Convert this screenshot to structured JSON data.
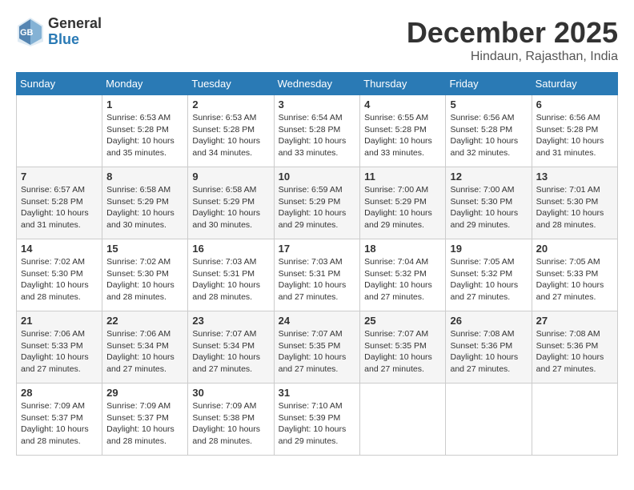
{
  "header": {
    "logo": {
      "general": "General",
      "blue": "Blue"
    },
    "title": "December 2025",
    "subtitle": "Hindaun, Rajasthan, India"
  },
  "calendar": {
    "columns": [
      "Sunday",
      "Monday",
      "Tuesday",
      "Wednesday",
      "Thursday",
      "Friday",
      "Saturday"
    ],
    "weeks": [
      [
        {
          "day": "",
          "info": ""
        },
        {
          "day": "1",
          "info": "Sunrise: 6:53 AM\nSunset: 5:28 PM\nDaylight: 10 hours\nand 35 minutes."
        },
        {
          "day": "2",
          "info": "Sunrise: 6:53 AM\nSunset: 5:28 PM\nDaylight: 10 hours\nand 34 minutes."
        },
        {
          "day": "3",
          "info": "Sunrise: 6:54 AM\nSunset: 5:28 PM\nDaylight: 10 hours\nand 33 minutes."
        },
        {
          "day": "4",
          "info": "Sunrise: 6:55 AM\nSunset: 5:28 PM\nDaylight: 10 hours\nand 33 minutes."
        },
        {
          "day": "5",
          "info": "Sunrise: 6:56 AM\nSunset: 5:28 PM\nDaylight: 10 hours\nand 32 minutes."
        },
        {
          "day": "6",
          "info": "Sunrise: 6:56 AM\nSunset: 5:28 PM\nDaylight: 10 hours\nand 31 minutes."
        }
      ],
      [
        {
          "day": "7",
          "info": "Sunrise: 6:57 AM\nSunset: 5:28 PM\nDaylight: 10 hours\nand 31 minutes."
        },
        {
          "day": "8",
          "info": "Sunrise: 6:58 AM\nSunset: 5:29 PM\nDaylight: 10 hours\nand 30 minutes."
        },
        {
          "day": "9",
          "info": "Sunrise: 6:58 AM\nSunset: 5:29 PM\nDaylight: 10 hours\nand 30 minutes."
        },
        {
          "day": "10",
          "info": "Sunrise: 6:59 AM\nSunset: 5:29 PM\nDaylight: 10 hours\nand 29 minutes."
        },
        {
          "day": "11",
          "info": "Sunrise: 7:00 AM\nSunset: 5:29 PM\nDaylight: 10 hours\nand 29 minutes."
        },
        {
          "day": "12",
          "info": "Sunrise: 7:00 AM\nSunset: 5:30 PM\nDaylight: 10 hours\nand 29 minutes."
        },
        {
          "day": "13",
          "info": "Sunrise: 7:01 AM\nSunset: 5:30 PM\nDaylight: 10 hours\nand 28 minutes."
        }
      ],
      [
        {
          "day": "14",
          "info": "Sunrise: 7:02 AM\nSunset: 5:30 PM\nDaylight: 10 hours\nand 28 minutes."
        },
        {
          "day": "15",
          "info": "Sunrise: 7:02 AM\nSunset: 5:30 PM\nDaylight: 10 hours\nand 28 minutes."
        },
        {
          "day": "16",
          "info": "Sunrise: 7:03 AM\nSunset: 5:31 PM\nDaylight: 10 hours\nand 28 minutes."
        },
        {
          "day": "17",
          "info": "Sunrise: 7:03 AM\nSunset: 5:31 PM\nDaylight: 10 hours\nand 27 minutes."
        },
        {
          "day": "18",
          "info": "Sunrise: 7:04 AM\nSunset: 5:32 PM\nDaylight: 10 hours\nand 27 minutes."
        },
        {
          "day": "19",
          "info": "Sunrise: 7:05 AM\nSunset: 5:32 PM\nDaylight: 10 hours\nand 27 minutes."
        },
        {
          "day": "20",
          "info": "Sunrise: 7:05 AM\nSunset: 5:33 PM\nDaylight: 10 hours\nand 27 minutes."
        }
      ],
      [
        {
          "day": "21",
          "info": "Sunrise: 7:06 AM\nSunset: 5:33 PM\nDaylight: 10 hours\nand 27 minutes."
        },
        {
          "day": "22",
          "info": "Sunrise: 7:06 AM\nSunset: 5:34 PM\nDaylight: 10 hours\nand 27 minutes."
        },
        {
          "day": "23",
          "info": "Sunrise: 7:07 AM\nSunset: 5:34 PM\nDaylight: 10 hours\nand 27 minutes."
        },
        {
          "day": "24",
          "info": "Sunrise: 7:07 AM\nSunset: 5:35 PM\nDaylight: 10 hours\nand 27 minutes."
        },
        {
          "day": "25",
          "info": "Sunrise: 7:07 AM\nSunset: 5:35 PM\nDaylight: 10 hours\nand 27 minutes."
        },
        {
          "day": "26",
          "info": "Sunrise: 7:08 AM\nSunset: 5:36 PM\nDaylight: 10 hours\nand 27 minutes."
        },
        {
          "day": "27",
          "info": "Sunrise: 7:08 AM\nSunset: 5:36 PM\nDaylight: 10 hours\nand 27 minutes."
        }
      ],
      [
        {
          "day": "28",
          "info": "Sunrise: 7:09 AM\nSunset: 5:37 PM\nDaylight: 10 hours\nand 28 minutes."
        },
        {
          "day": "29",
          "info": "Sunrise: 7:09 AM\nSunset: 5:37 PM\nDaylight: 10 hours\nand 28 minutes."
        },
        {
          "day": "30",
          "info": "Sunrise: 7:09 AM\nSunset: 5:38 PM\nDaylight: 10 hours\nand 28 minutes."
        },
        {
          "day": "31",
          "info": "Sunrise: 7:10 AM\nSunset: 5:39 PM\nDaylight: 10 hours\nand 29 minutes."
        },
        {
          "day": "",
          "info": ""
        },
        {
          "day": "",
          "info": ""
        },
        {
          "day": "",
          "info": ""
        }
      ]
    ]
  }
}
